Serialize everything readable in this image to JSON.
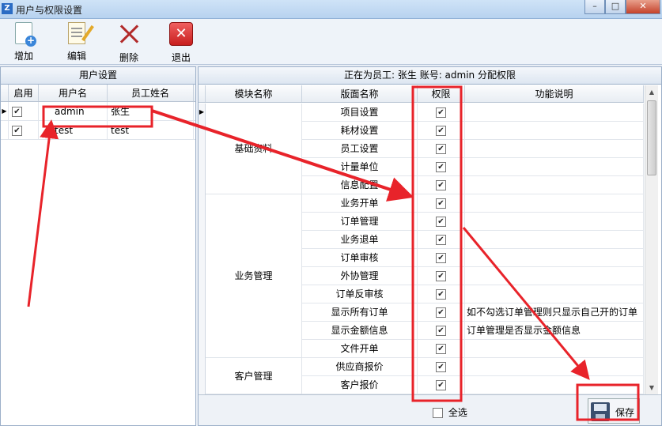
{
  "window": {
    "title": "用户与权限设置",
    "buttons": [
      "minimize",
      "maximize",
      "close"
    ]
  },
  "toolbar": {
    "add": "增加",
    "edit": "编辑",
    "delete": "删除",
    "exit": "退出"
  },
  "users": {
    "title": "用户设置",
    "columns": [
      "启用",
      "用户名",
      "员工姓名"
    ],
    "rows": [
      {
        "enabled": true,
        "username": "admin",
        "name": "张生"
      },
      {
        "enabled": true,
        "username": "test",
        "name": "test"
      }
    ]
  },
  "permissions": {
    "title": "正在为员工: 张生 账号: admin 分配权限",
    "columns": [
      "模块名称",
      "版面名称",
      "权限",
      "功能说明"
    ],
    "modules": [
      {
        "name": "基础资料",
        "pages": [
          {
            "page": "项目设置",
            "checked": true,
            "desc": ""
          },
          {
            "page": "耗材设置",
            "checked": true,
            "desc": ""
          },
          {
            "page": "员工设置",
            "checked": true,
            "desc": ""
          },
          {
            "page": "计量单位",
            "checked": true,
            "desc": ""
          },
          {
            "page": "信息配置",
            "checked": true,
            "desc": ""
          }
        ]
      },
      {
        "name": "业务管理",
        "pages": [
          {
            "page": "业务开单",
            "checked": true,
            "desc": ""
          },
          {
            "page": "订单管理",
            "checked": true,
            "desc": ""
          },
          {
            "page": "业务退单",
            "checked": true,
            "desc": ""
          },
          {
            "page": "订单审核",
            "checked": true,
            "desc": ""
          },
          {
            "page": "外协管理",
            "checked": true,
            "desc": ""
          },
          {
            "page": "订单反审核",
            "checked": true,
            "desc": ""
          },
          {
            "page": "显示所有订单",
            "checked": true,
            "desc": "如不勾选订单管理则只显示自己开的订单"
          },
          {
            "page": "显示金额信息",
            "checked": true,
            "desc": "订单管理是否显示金额信息"
          },
          {
            "page": "文件开单",
            "checked": true,
            "desc": ""
          }
        ]
      },
      {
        "name": "客户管理",
        "pages": [
          {
            "page": "供应商报价",
            "checked": true,
            "desc": ""
          },
          {
            "page": "客户报价",
            "checked": true,
            "desc": ""
          }
        ]
      }
    ],
    "select_all": "全选",
    "select_all_checked": false,
    "save": "保存"
  },
  "colors": {
    "annotation": "#e8232a",
    "title_bar": "#c4dbf3",
    "header": "#e8edf3"
  }
}
